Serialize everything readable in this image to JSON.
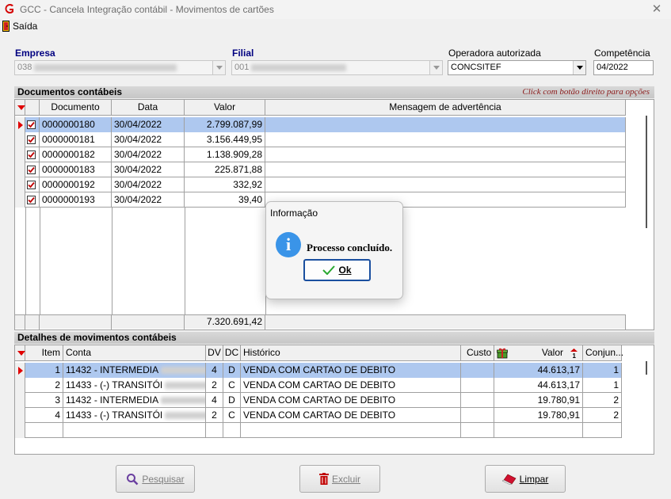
{
  "window": {
    "title": "GCC - Cancela Integração contábil - Movimentos de cartões"
  },
  "menu": {
    "exit_label": "Saída"
  },
  "fields": {
    "empresa_label": "Empresa",
    "empresa_value": "038",
    "filial_label": "Filial",
    "filial_value": "001",
    "operadora_label": "Operadora autorizada",
    "operadora_value": "CONCSITEF",
    "competencia_label": "Competência",
    "competencia_value": "04/2022"
  },
  "documents": {
    "title": "Documentos contábeis",
    "hint": "Click com botão direito para opções",
    "columns": [
      "Documento",
      "Data",
      "Valor",
      "Mensagem de advertência"
    ],
    "rows": [
      {
        "documento": "0000000180",
        "data": "30/04/2022",
        "valor": "2.799.087,99",
        "mensagem": ""
      },
      {
        "documento": "0000000181",
        "data": "30/04/2022",
        "valor": "3.156.449,95",
        "mensagem": ""
      },
      {
        "documento": "0000000182",
        "data": "30/04/2022",
        "valor": "1.138.909,28",
        "mensagem": ""
      },
      {
        "documento": "0000000183",
        "data": "30/04/2022",
        "valor": "225.871,88",
        "mensagem": ""
      },
      {
        "documento": "0000000192",
        "data": "30/04/2022",
        "valor": "332,92",
        "mensagem": ""
      },
      {
        "documento": "0000000193",
        "data": "30/04/2022",
        "valor": "39,40",
        "mensagem": ""
      }
    ],
    "total": "7.320.691,42"
  },
  "details": {
    "title": "Detalhes de movimentos contábeis",
    "columns": {
      "item": "Item",
      "conta": "Conta",
      "dv": "DV",
      "dc": "DC",
      "historico": "Histórico",
      "custo": "Custo",
      "valor": "Valor",
      "conjunto": "Conjun..."
    },
    "rows": [
      {
        "item": "1",
        "conta": "11432 - INTERMEDIA",
        "dv": "4",
        "dc": "D",
        "historico": "VENDA COM CARTAO DE DEBITO",
        "custo": "",
        "valor": "44.613,17",
        "conjunto": "1"
      },
      {
        "item": "2",
        "conta": "11433 - (-) TRANSITÓI",
        "dv": "2",
        "dc": "C",
        "historico": "VENDA COM CARTAO DE DEBITO",
        "custo": "",
        "valor": "44.613,17",
        "conjunto": "1"
      },
      {
        "item": "3",
        "conta": "11432 - INTERMEDIA",
        "dv": "4",
        "dc": "D",
        "historico": "VENDA COM CARTAO DE DEBITO",
        "custo": "",
        "valor": "19.780,91",
        "conjunto": "2"
      },
      {
        "item": "4",
        "conta": "11433 - (-) TRANSITÓI",
        "dv": "2",
        "dc": "C",
        "historico": "VENDA COM CARTAO DE DEBITO",
        "custo": "",
        "valor": "19.780,91",
        "conjunto": "2"
      }
    ]
  },
  "dialog": {
    "title": "Informação",
    "message": "Processo concluído.",
    "ok_label": "Ok"
  },
  "buttons": {
    "pesquisar": "Pesquisar",
    "excluir": "Excluir",
    "limpar": "Limpar"
  },
  "colors": {
    "selected_row": "#aec8ef",
    "indicator": "#e00000",
    "field_label": "#000080",
    "info_icon": "#3a94e8"
  }
}
